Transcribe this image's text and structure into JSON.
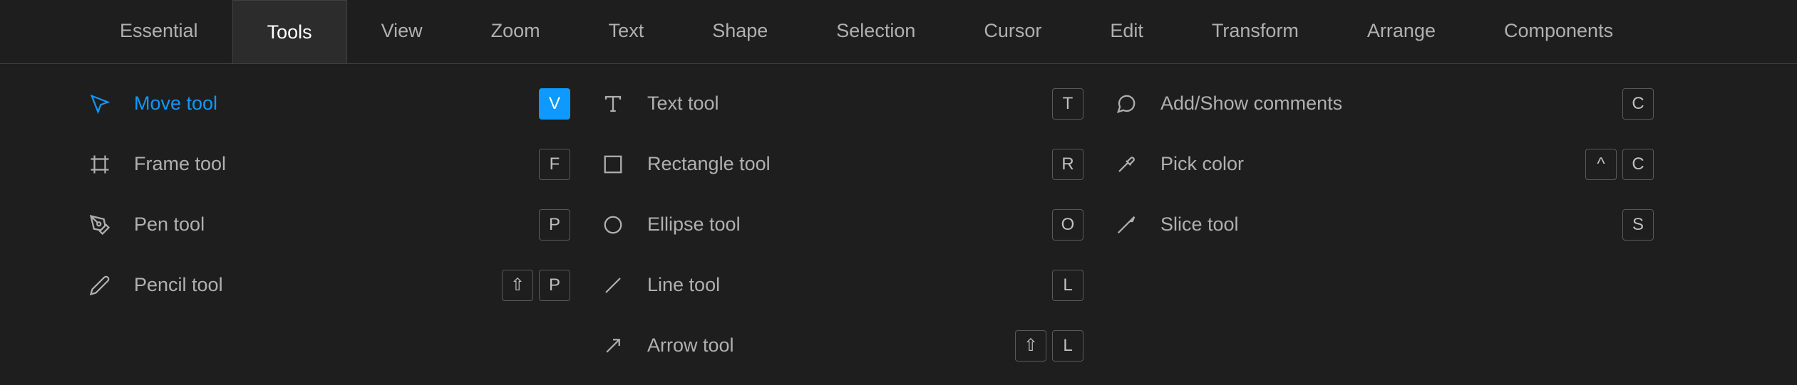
{
  "tabs": [
    {
      "label": "Essential"
    },
    {
      "label": "Tools"
    },
    {
      "label": "View"
    },
    {
      "label": "Zoom"
    },
    {
      "label": "Text"
    },
    {
      "label": "Shape"
    },
    {
      "label": "Selection"
    },
    {
      "label": "Cursor"
    },
    {
      "label": "Edit"
    },
    {
      "label": "Transform"
    },
    {
      "label": "Arrange"
    },
    {
      "label": "Components"
    }
  ],
  "active_tab_index": 1,
  "tools": {
    "col1": [
      {
        "name": "Move tool",
        "keys": [
          "V"
        ],
        "active": true,
        "icon": "move"
      },
      {
        "name": "Frame tool",
        "keys": [
          "F"
        ],
        "icon": "frame"
      },
      {
        "name": "Pen tool",
        "keys": [
          "P"
        ],
        "icon": "pen"
      },
      {
        "name": "Pencil tool",
        "keys": [
          "⇧",
          "P"
        ],
        "icon": "pencil"
      }
    ],
    "col2": [
      {
        "name": "Text tool",
        "keys": [
          "T"
        ],
        "icon": "text"
      },
      {
        "name": "Rectangle tool",
        "keys": [
          "R"
        ],
        "icon": "rectangle"
      },
      {
        "name": "Ellipse tool",
        "keys": [
          "O"
        ],
        "icon": "ellipse"
      },
      {
        "name": "Line tool",
        "keys": [
          "L"
        ],
        "icon": "line"
      },
      {
        "name": "Arrow tool",
        "keys": [
          "⇧",
          "L"
        ],
        "icon": "arrow"
      }
    ],
    "col3": [
      {
        "name": "Add/Show comments",
        "keys": [
          "C"
        ],
        "icon": "comment"
      },
      {
        "name": "Pick color",
        "keys": [
          "^",
          "C"
        ],
        "icon": "eyedropper"
      },
      {
        "name": "Slice tool",
        "keys": [
          "S"
        ],
        "icon": "slice"
      }
    ]
  }
}
